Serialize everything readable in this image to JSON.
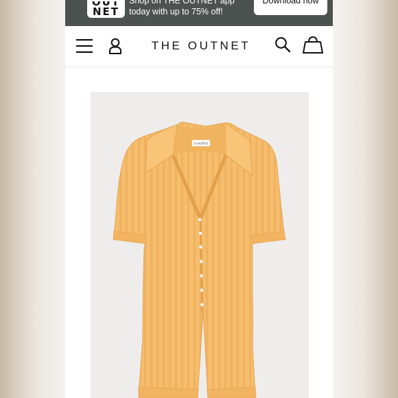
{
  "banner": {
    "app_logo_top": "OUT",
    "app_logo_bottom": "NET",
    "text_line1": "Shop on THE OUTNET app",
    "text_line2": "today with up to 75% off!",
    "download_label": "Download now"
  },
  "header": {
    "brand": "THE OUTNET",
    "icons": [
      "menu-icon",
      "account-icon",
      "search-icon",
      "bag-icon"
    ]
  },
  "product": {
    "garment_label": "SANDRO",
    "garment_color": "#f6bd6c",
    "background_color": "#efedeb"
  }
}
